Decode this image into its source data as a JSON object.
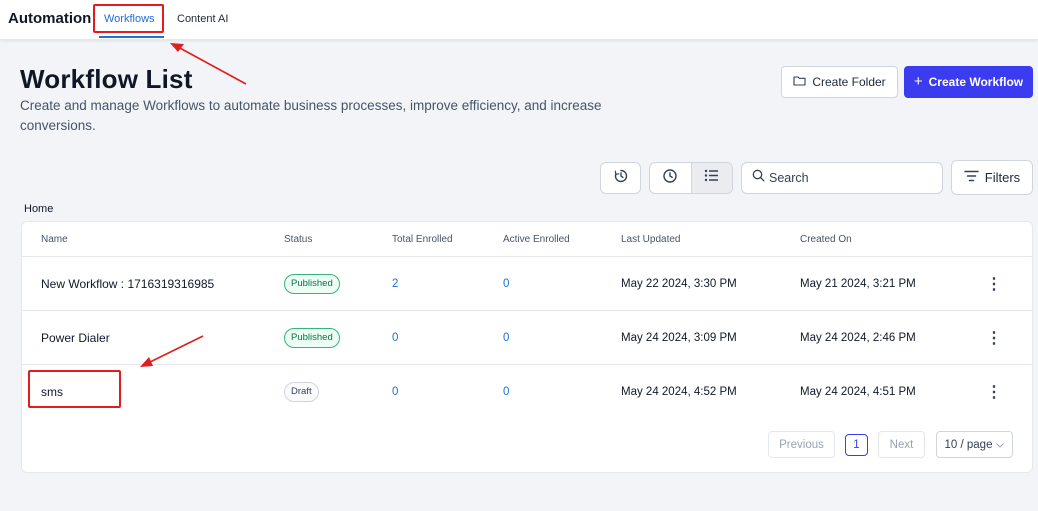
{
  "header": {
    "app_title": "Automation",
    "tabs": [
      {
        "label": "Workflows",
        "active": true
      },
      {
        "label": "Content AI",
        "active": false
      }
    ]
  },
  "page": {
    "title": "Workflow List",
    "description": "Create and manage Workflows to automate business processes, improve efficiency, and increase conversions."
  },
  "actions": {
    "create_folder": "Create Folder",
    "create_workflow": "Create Workflow",
    "create_workflow_icon": "plus",
    "folder_icon": "folder-icon"
  },
  "toolbar": {
    "search_placeholder": "Search",
    "filters_label": "Filters",
    "view_modes": [
      "history-icon",
      "clock-icon",
      "list-icon"
    ],
    "active_view": "list-icon"
  },
  "breadcrumb": "Home",
  "table": {
    "columns": [
      "Name",
      "Status",
      "Total Enrolled",
      "Active Enrolled",
      "Last Updated",
      "Created On"
    ],
    "rows": [
      {
        "name": "New Workflow : 1716319316985",
        "status": "Published",
        "total_enrolled": "2",
        "active_enrolled": "0",
        "last_updated": "May 22 2024, 3:30 PM",
        "created_on": "May 21 2024, 3:21 PM"
      },
      {
        "name": "Power Dialer",
        "status": "Published",
        "total_enrolled": "0",
        "active_enrolled": "0",
        "last_updated": "May 24 2024, 3:09 PM",
        "created_on": "May 24 2024, 2:46 PM"
      },
      {
        "name": "sms",
        "status": "Draft",
        "total_enrolled": "0",
        "active_enrolled": "0",
        "last_updated": "May 24 2024, 4:52 PM",
        "created_on": "May 24 2024, 4:51 PM"
      }
    ]
  },
  "pagination": {
    "previous": "Previous",
    "current_page": "1",
    "next": "Next",
    "page_size": "10 / page"
  },
  "colors": {
    "accent": "#3b3bf0",
    "link": "#1e6fd9",
    "annotation": "#e11d1d",
    "published": "#067647"
  }
}
